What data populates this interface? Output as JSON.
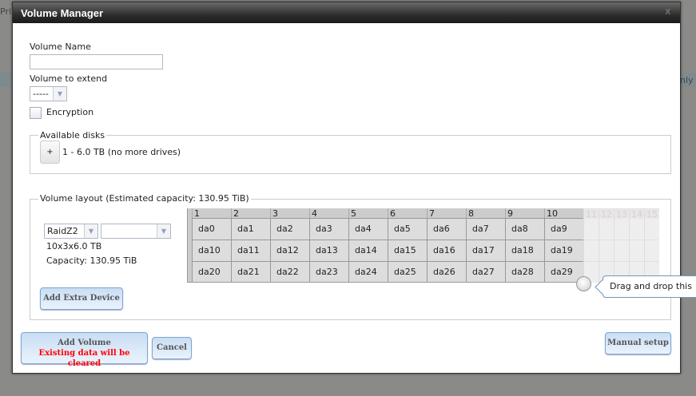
{
  "background": {
    "left_text": "Pri",
    "right_text": "nly"
  },
  "dialog": {
    "title": "Volume Manager",
    "close_label": "X",
    "volume_name_label": "Volume Name",
    "volume_name_value": "",
    "volume_extend_label": "Volume to extend",
    "volume_extend_value": "-----",
    "encryption_label": "Encryption",
    "available_disks": {
      "legend": "Available disks",
      "add_label": "+",
      "disk_text": "1 - 6.0 TB (no more drives)"
    },
    "layout": {
      "legend": "Volume layout (Estimated capacity: 130.95 TiB)",
      "raid_type": "RaidZ2",
      "second_select": "",
      "geometry": "10x3x6.0 TB",
      "capacity": "Capacity: 130.95 TiB",
      "add_extra_label": "Add Extra Device",
      "columns": [
        "1",
        "2",
        "3",
        "4",
        "5",
        "6",
        "7",
        "8",
        "9",
        "10"
      ],
      "extra_columns": [
        "11",
        "12",
        "13",
        "14",
        "15"
      ],
      "rows": [
        [
          "da0",
          "da1",
          "da2",
          "da3",
          "da4",
          "da5",
          "da6",
          "da7",
          "da8",
          "da9"
        ],
        [
          "da10",
          "da11",
          "da12",
          "da13",
          "da14",
          "da15",
          "da16",
          "da17",
          "da18",
          "da19"
        ],
        [
          "da20",
          "da21",
          "da22",
          "da23",
          "da24",
          "da25",
          "da26",
          "da27",
          "da28",
          "da29"
        ]
      ],
      "tooltip": "Drag and drop this"
    },
    "add_volume_label": "Add Volume",
    "add_volume_warning": "Existing data will be cleared",
    "cancel_label": "Cancel",
    "manual_setup_label": "Manual setup",
    "warning_color": "#ff0000"
  }
}
